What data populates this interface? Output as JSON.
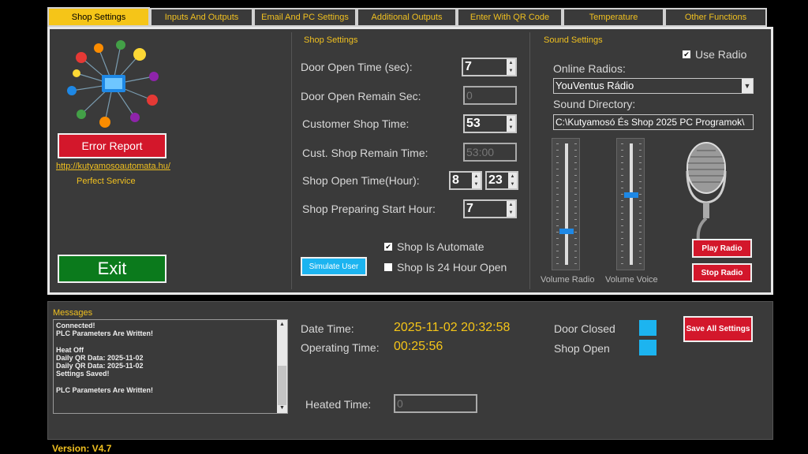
{
  "tabs": [
    "Shop Settings",
    "Inputs And Outputs",
    "Email And PC Settings",
    "Additional Outputs",
    "Enter With QR Code",
    "Temperature",
    "Other Functions"
  ],
  "left": {
    "error_report": "Error Report",
    "link": "http://kutyamosoautomata.hu/",
    "slogan": "Perfect Service",
    "exit": "Exit"
  },
  "shop": {
    "title": "Shop Settings",
    "door_open_time_label": "Door Open Time (sec):",
    "door_open_time": "7",
    "door_open_remain_label": "Door Open Remain Sec:",
    "door_open_remain": "0",
    "customer_shop_time_label": "Customer Shop Time:",
    "customer_shop_time": "53",
    "cust_shop_remain_label": "Cust. Shop Remain Time:",
    "cust_shop_remain": "53:00",
    "shop_open_time_label": "Shop Open  Time(Hour):",
    "shop_open_from": "8",
    "shop_open_to": "23",
    "preparing_start_label": "Shop Preparing Start Hour:",
    "preparing_start": "7",
    "simulate_user": "Simulate User",
    "shop_is_automate": "Shop Is Automate",
    "shop_is_24h": "Shop Is 24 Hour Open"
  },
  "sound": {
    "title": "Sound Settings",
    "use_radio": "Use Radio",
    "online_radios_label": "Online Radios:",
    "online_radio": "YouVentus Rádio",
    "sound_directory_label": "Sound Directory:",
    "sound_directory": "C:\\Kutyamosó És Shop 2025 PC Programok\\",
    "volume_radio_label": "Volume Radio",
    "volume_voice_label": "Volume Voice",
    "volume_radio": 0.28,
    "volume_voice": 0.58,
    "play_radio": "Play Radio",
    "stop_radio": "Stop Radio"
  },
  "messages": {
    "title": "Messages",
    "lines": [
      "Connected!",
      "PLC Parameters Are Written!",
      "",
      "Heat Off",
      "Daily QR Data: 2025-11-02",
      "Daily QR Data: 2025-11-02",
      "Settings Saved!",
      "",
      "PLC Parameters Are Written!"
    ]
  },
  "status": {
    "date_time_label": "Date  Time:",
    "date_time": "2025-11-02 20:32:58",
    "operating_time_label": "Operating Time:",
    "operating_time": "00:25:56",
    "door_closed_label": "Door Closed",
    "shop_open_label": "Shop Open",
    "save_all": "Save All Settings",
    "heated_time_label": "Heated Time:",
    "heated_time": "0"
  },
  "version": "Version: V4.7",
  "colors": {
    "accent_yellow": "#f5c518",
    "button_red": "#d3172b",
    "exit_green": "#0b7a1c",
    "indicator_cyan": "#1cb4f0",
    "panel_bg": "#3a3a3a"
  }
}
